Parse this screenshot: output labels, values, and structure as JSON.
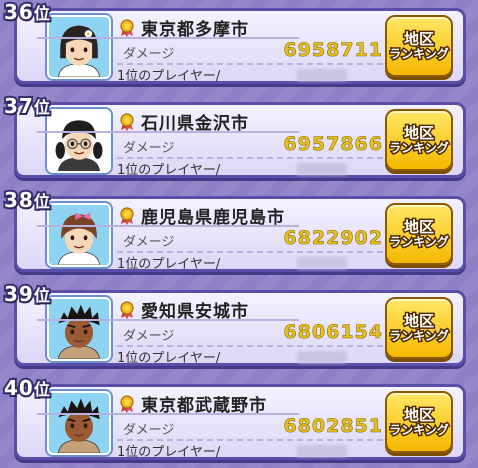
{
  "rows": [
    {
      "rank": "36",
      "rank_suffix": "位",
      "city": "東京都多摩市",
      "damage_label": "ダメージ",
      "damage": "6958711",
      "player_label": "1位のプレイヤー/",
      "button_line1": "地区",
      "button_line2": "ランキング",
      "avatar": "girl-bob-flower",
      "avatar_bg": "#8fd3f2"
    },
    {
      "rank": "37",
      "rank_suffix": "位",
      "city": "石川県金沢市",
      "damage_label": "ダメージ",
      "damage": "6957866",
      "player_label": "1位のプレイヤー/",
      "button_line1": "地区",
      "button_line2": "ランキング",
      "avatar": "girl-glasses-pigtails",
      "avatar_bg": "#ffffff"
    },
    {
      "rank": "38",
      "rank_suffix": "位",
      "city": "鹿児島県鹿児島市",
      "damage_label": "ダメージ",
      "damage": "6822902",
      "player_label": "1位のプレイヤー/",
      "button_line1": "地区",
      "button_line2": "ランキング",
      "avatar": "girl-brown-bow",
      "avatar_bg": "#8fd3f2"
    },
    {
      "rank": "39",
      "rank_suffix": "位",
      "city": "愛知県安城市",
      "damage_label": "ダメージ",
      "damage": "6806154",
      "player_label": "1位のプレイヤー/",
      "button_line1": "地区",
      "button_line2": "ランキング",
      "avatar": "boy-spiky-tan",
      "avatar_bg": "#8fd3f2"
    },
    {
      "rank": "40",
      "rank_suffix": "位",
      "city": "東京都武蔵野市",
      "damage_label": "ダメージ",
      "damage": "6802851",
      "player_label": "1位のプレイヤー/",
      "button_line1": "地区",
      "button_line2": "ランキング",
      "avatar": "boy-spiky-tan",
      "avatar_bg": "#8fd3f2"
    }
  ],
  "colors": {
    "damage_text": "#e8c21c",
    "card_border": "#5b4ea8",
    "button_fill": "#f5b800",
    "background": "#8f7fc7"
  }
}
